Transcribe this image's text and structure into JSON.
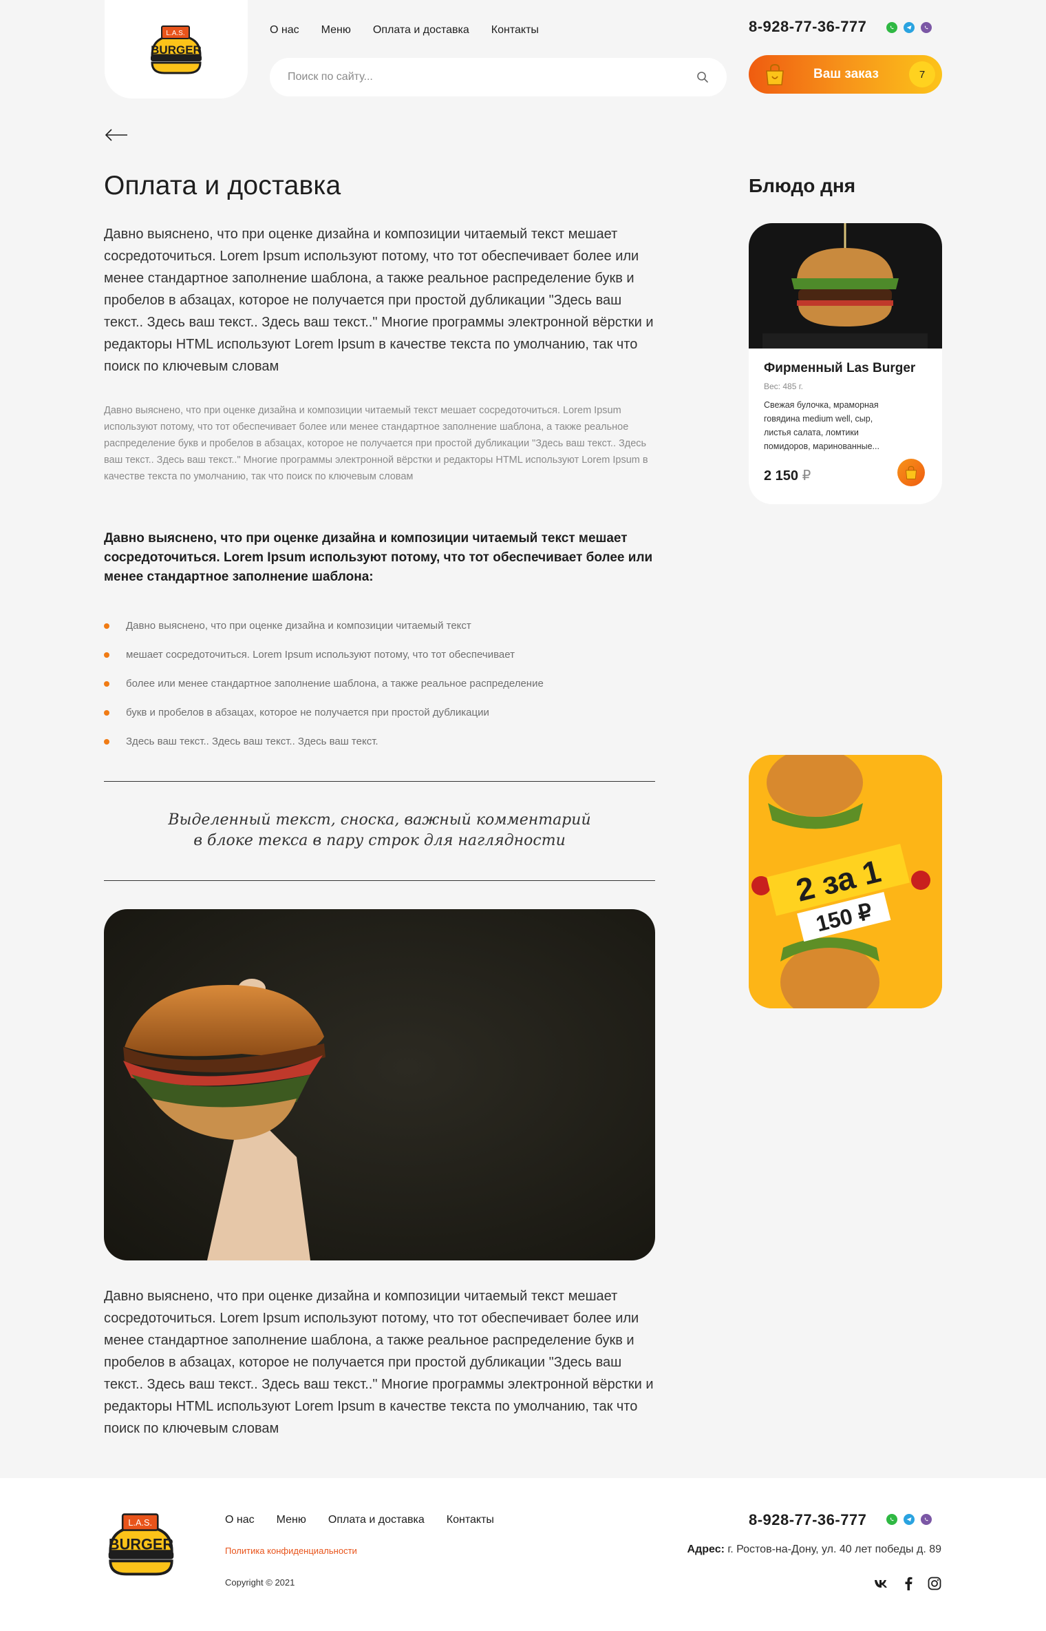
{
  "header": {
    "logo_top_text": "L.A.S.",
    "logo_text": "BURGER",
    "nav": [
      "О нас",
      "Меню",
      "Оплата и доставка",
      "Контакты"
    ],
    "search_placeholder": "Поиск по сайту...",
    "phone": "8-928-77-36-777",
    "social_icons": [
      "whatsapp-icon",
      "telegram-icon",
      "viber-icon"
    ],
    "cart_label": "Ваш заказ",
    "cart_count": "7"
  },
  "colors": {
    "accent_orange": "#ef5c10",
    "accent_yellow": "#fcc319",
    "whatsapp": "#2fb843",
    "telegram": "#2aa3e0",
    "viber": "#7b57a5",
    "link_orange": "#e8541b"
  },
  "main": {
    "title": "Оплата и доставка",
    "paragraph1": "Давно выяснено, что при оценке дизайна и композиции читаемый текст мешает сосредоточиться. Lorem Ipsum используют потому, что тот обеспечивает более или менее стандартное заполнение шаблона, а также реальное распределение букв и пробелов в абзацах, которое не получается при простой дубликации \"Здесь ваш текст.. Здесь ваш текст.. Здесь ваш текст..\" Многие программы электронной вёрстки и редакторы HTML используют Lorem Ipsum в качестве текста по умолчанию, так что поиск по ключевым словам",
    "paragraph2": "Давно выяснено, что при оценке дизайна и композиции читаемый текст мешает сосредоточиться. Lorem Ipsum используют потому, что тот обеспечивает более или менее стандартное заполнение шаблона, а также реальное распределение букв и пробелов в абзацах, которое не получается при простой дубликации \"Здесь ваш текст.. Здесь ваш текст.. Здесь ваш текст..\" Многие программы электронной вёрстки и редакторы HTML используют Lorem Ipsum в качестве текста по умолчанию, так что поиск по ключевым словам",
    "paragraph3": "Давно выяснено, что при оценке дизайна и композиции читаемый текст мешает сосредоточиться. Lorem Ipsum используют потому, что тот обеспечивает более или менее стандартное заполнение шаблона:",
    "bullets": [
      "Давно выяснено, что при оценке дизайна и композиции читаемый текст",
      "мешает сосредоточиться. Lorem Ipsum используют потому, что тот обеспечивает",
      "более или менее стандартное заполнение шаблона, а также реальное распределение",
      "букв и пробелов в абзацах, которое не получается при простой дубликации",
      "Здесь ваш текст.. Здесь ваш текст.. Здесь ваш текст."
    ],
    "quote_line1": "Выделенный текст, сноска, важный комментарий",
    "quote_line2": "в блоке текса в пару строк для наглядности",
    "paragraph4": "Давно выяснено, что при оценке дизайна и композиции читаемый текст мешает сосредоточиться. Lorem Ipsum используют потому, что тот обеспечивает более или менее стандартное заполнение шаблона, а также реальное распределение букв и пробелов в абзацах, которое не получается при простой дубликации \"Здесь ваш текст.. Здесь ваш текст.. Здесь ваш текст..\" Многие программы электронной вёрстки и редакторы HTML используют Lorem Ipsum в качестве текста по умолчанию, так что поиск по ключевым словам"
  },
  "sidebar": {
    "title": "Блюдо дня",
    "dish": {
      "name": "Фирменный Las Burger",
      "weight": "Вес: 485 г.",
      "description": "Свежая булочка, мраморная говядина medium well, сыр, листья салата, ломтики помидоров, маринованные...",
      "price": "2 150",
      "currency": "₽"
    },
    "promo": {
      "line1": "2 за 1",
      "line2": "150 ₽"
    }
  },
  "footer": {
    "nav": [
      "О нас",
      "Меню",
      "Оплата и доставка",
      "Контакты"
    ],
    "policy": "Политика конфиденциальности",
    "copyright": "Copyright © 2021",
    "phone": "8-928-77-36-777",
    "address_label": "Адрес:",
    "address": "г. Ростов-на-Дону, ул. 40 лет победы д. 89",
    "social_icons": [
      "vk-icon",
      "facebook-icon",
      "instagram-icon"
    ]
  }
}
